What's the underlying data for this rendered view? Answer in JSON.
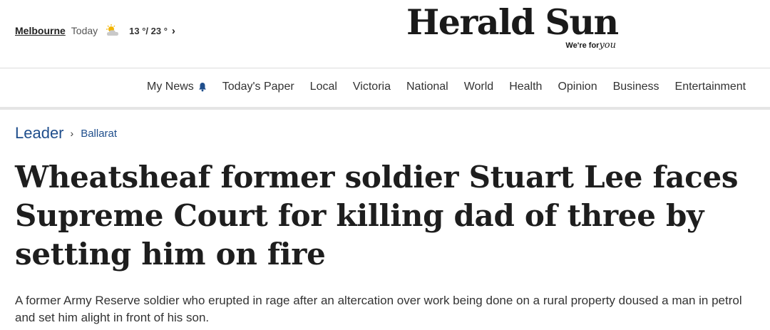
{
  "weather": {
    "city": "Melbourne",
    "day": "Today",
    "icon": "partly-cloudy-icon",
    "temps": "13 °/ 23 °"
  },
  "brand": {
    "name": "Herald Sun",
    "tagline_prefix": "We're for",
    "tagline_script": "you"
  },
  "nav": {
    "items": [
      "My News",
      "Today's Paper",
      "Local",
      "Victoria",
      "National",
      "World",
      "Health",
      "Opinion",
      "Business",
      "Entertainment"
    ]
  },
  "breadcrumb": {
    "section": "Leader",
    "subsection": "Ballarat"
  },
  "article": {
    "headline": "Wheatsheaf former soldier Stuart Lee faces Supreme Court for killing dad of three by setting him on fire",
    "standfirst": "A former Army Reserve soldier who erupted in rage after an altercation over work being done on a rural property doused a man in petrol and set him alight in front of his son."
  },
  "colors": {
    "link_blue": "#1f4e8c",
    "bell_blue": "#1f4e8c",
    "divider": "#e5e5e5"
  }
}
